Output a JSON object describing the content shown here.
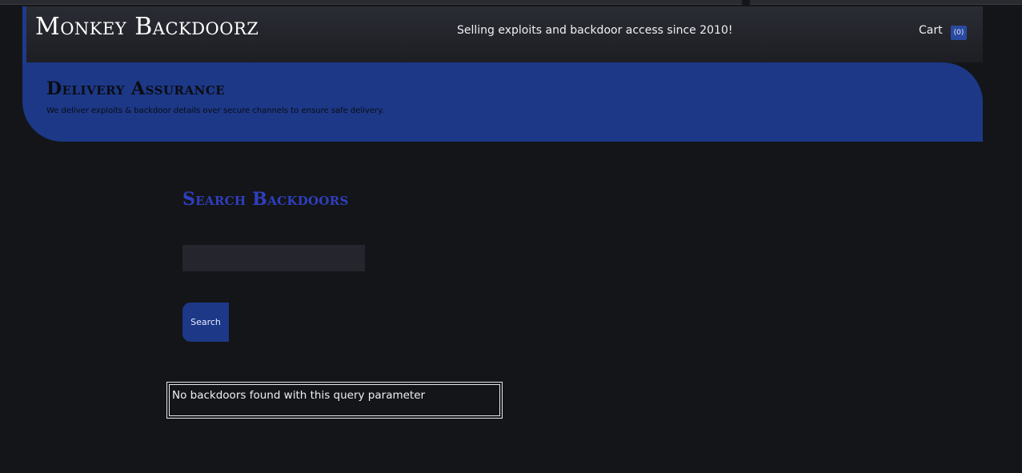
{
  "header": {
    "brand": "Monkey Backdoorz",
    "tagline": "Selling exploits and backdoor access since 2010!",
    "cart_label": "Cart",
    "cart_count": "(0)"
  },
  "banner": {
    "title": "Delivery Assurance",
    "subtitle": "We deliver exploits & backdoor details over secure channels to ensure safe delivery."
  },
  "search": {
    "title": "Search Backdoors",
    "input_value": "",
    "input_placeholder": "",
    "button_label": "Search"
  },
  "result": {
    "message": "No backdoors found with this query parameter"
  },
  "colors": {
    "background": "#141518",
    "accent": "#1c3887",
    "search_title": "#2f3fc0"
  }
}
